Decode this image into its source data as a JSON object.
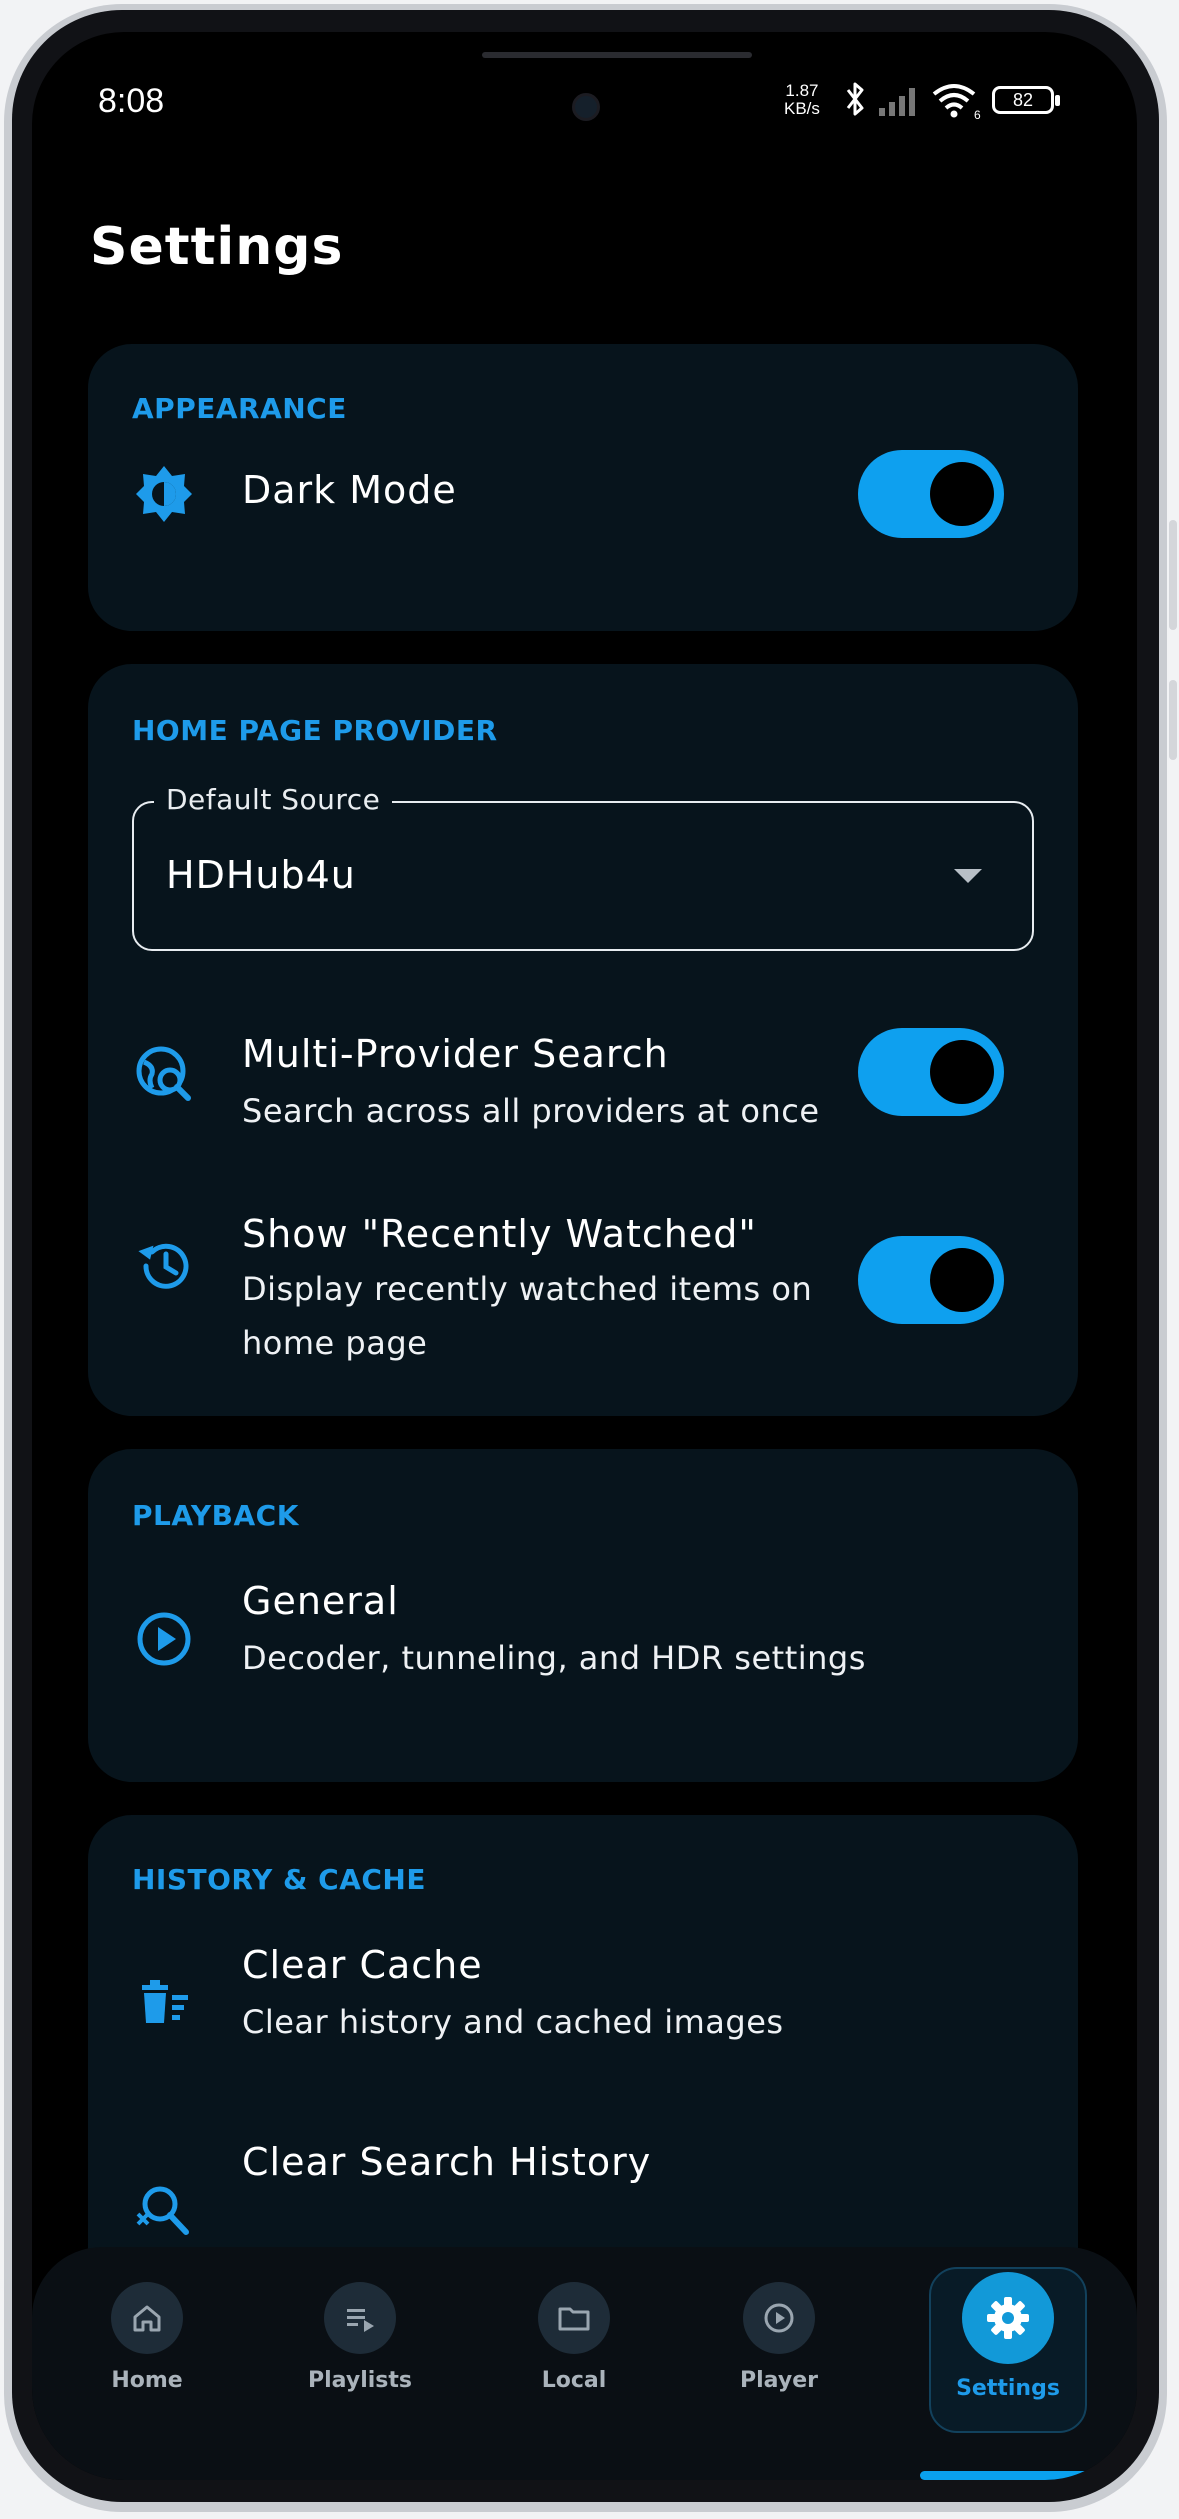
{
  "status_bar": {
    "time": "8:08",
    "net_speed_value": "1.87",
    "net_speed_unit": "KB/s",
    "wifi_badge": "6",
    "battery": "82",
    "icons": [
      "bluetooth-icon",
      "signal-icon",
      "wifi-icon",
      "battery-icon"
    ]
  },
  "header": {
    "title": "Settings"
  },
  "sections": {
    "appearance": {
      "label": "APPEARANCE",
      "dark_mode": {
        "title": "Dark Mode",
        "enabled": true,
        "icon": "brightness-icon"
      }
    },
    "home_page_provider": {
      "label": "HOME PAGE PROVIDER",
      "default_source": {
        "legend": "Default Source",
        "value": "HDHub4u"
      },
      "multi_provider": {
        "title": "Multi-Provider Search",
        "subtitle": "Search across all providers at once",
        "enabled": true,
        "icon": "globe-search-icon"
      },
      "recently_watched": {
        "title": "Show \"Recently Watched\"",
        "subtitle_line1": "Display recently watched items on",
        "subtitle_line2": "home page",
        "enabled": true,
        "icon": "history-icon"
      }
    },
    "playback": {
      "label": "PLAYBACK",
      "general": {
        "title": "General",
        "subtitle": "Decoder, tunneling, and HDR settings",
        "icon": "play-circle-icon"
      }
    },
    "history_cache": {
      "label": "HISTORY & CACHE",
      "clear_cache": {
        "title": "Clear Cache",
        "subtitle": "Clear history and cached images",
        "icon": "delete-sweep-icon"
      },
      "clear_search": {
        "title": "Clear Search History",
        "icon": "search-off-icon"
      }
    }
  },
  "nav": {
    "items": [
      {
        "label": "Home",
        "icon": "home-icon"
      },
      {
        "label": "Playlists",
        "icon": "playlist-icon"
      },
      {
        "label": "Local",
        "icon": "folder-icon"
      },
      {
        "label": "Player",
        "icon": "play-icon"
      },
      {
        "label": "Settings",
        "icon": "gear-icon",
        "active": true
      }
    ]
  },
  "colors": {
    "accent": "#1e9bea",
    "toggle_on": "#0ea0ef",
    "card_bg": "#07141c",
    "screen_bg": "#000000"
  }
}
